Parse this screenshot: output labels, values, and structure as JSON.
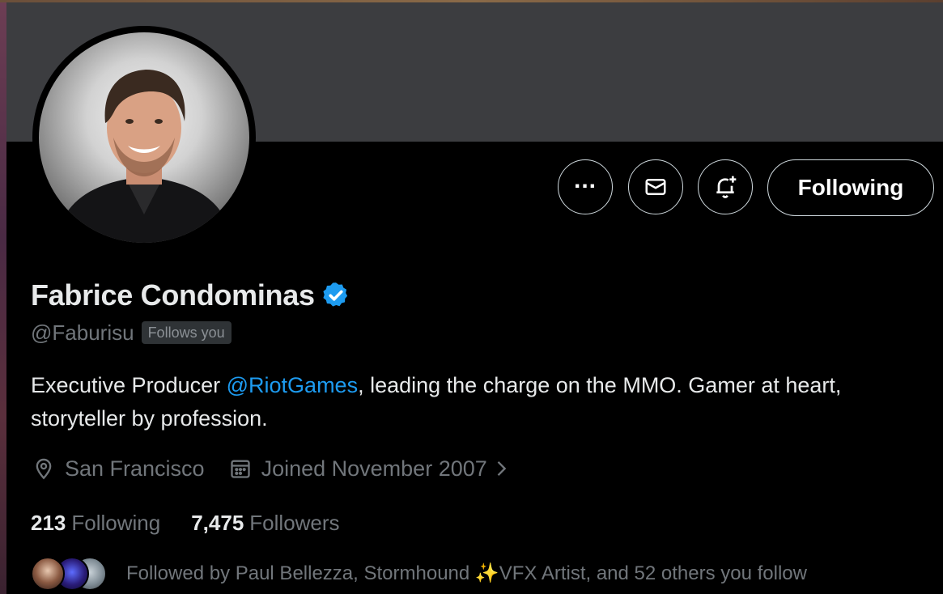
{
  "profile": {
    "display_name": "Fabrice Condominas",
    "handle": "@Faburisu",
    "follows_you_badge": "Follows you",
    "verified": true
  },
  "actions": {
    "more_icon": "more-dots-icon",
    "message_icon": "envelope-icon",
    "notify_icon": "bell-plus-icon",
    "follow_label": "Following"
  },
  "bio": {
    "before": "Executive Producer ",
    "mention": "@RiotGames",
    "after": ", leading the charge on the MMO. Gamer at heart, storyteller by profession."
  },
  "meta": {
    "location": "San Francisco",
    "joined": "Joined November 2007"
  },
  "stats": {
    "following_count": "213",
    "following_label": "Following",
    "followers_count": "7,475",
    "followers_label": "Followers"
  },
  "followed_by": {
    "prefix": "Followed by Paul Bellezza, Stormhound ",
    "emoji": "✨",
    "suffix": "VFX Artist, and 52 others you follow"
  },
  "colors": {
    "accent": "#1d9bf0",
    "text_primary": "#e7e9ea",
    "text_secondary": "#71767b",
    "banner": "#3c3d40",
    "background": "#000000"
  }
}
